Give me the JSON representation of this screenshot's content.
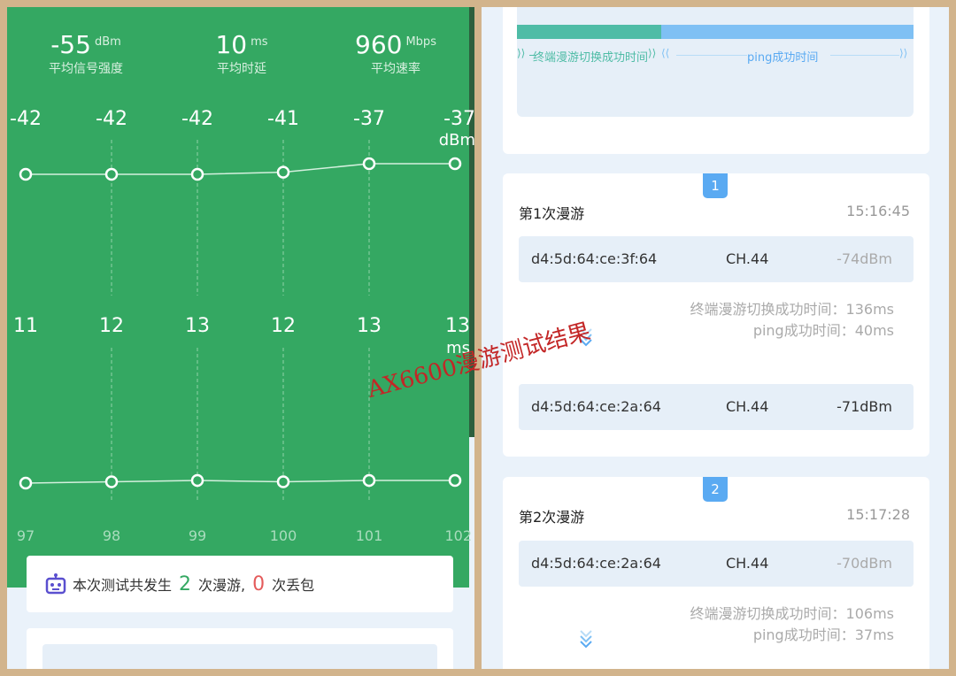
{
  "left": {
    "stats": [
      {
        "value": "-55",
        "unit": "dBm",
        "label": "平均信号强度"
      },
      {
        "value": "10",
        "unit": "ms",
        "label": "平均时延"
      },
      {
        "value": "960",
        "unit": "Mbps",
        "label": "平均速率"
      }
    ],
    "summary": {
      "prefix": "本次测试共发生",
      "roam_count": "2",
      "roam_label": "次漫游,",
      "loss_count": "0",
      "loss_label": "次丢包"
    }
  },
  "chart_data": {
    "type": "line",
    "x": [
      "97",
      "98",
      "99",
      "100",
      "101",
      "102"
    ],
    "series": [
      {
        "name": "",
        "unit": "dBm",
        "values": [
          -42,
          -42,
          -42,
          -41,
          -37,
          -37
        ]
      },
      {
        "name": "",
        "unit": "ms",
        "values": [
          11,
          12,
          13,
          12,
          13,
          13
        ]
      }
    ],
    "signal_labels": [
      "-42",
      "-42",
      "-42",
      "-41",
      "-37",
      "-37"
    ],
    "latency_labels": [
      "11",
      "12",
      "13",
      "12",
      "13",
      "13"
    ],
    "signal_unit": "dBm",
    "latency_unit": "ms"
  },
  "right": {
    "legend": {
      "left_label": "终端漫游切换成功时间",
      "right_label": "ping成功时间",
      "color_left": "#4fbca6",
      "color_right": "#7fc0f4"
    },
    "roams": [
      {
        "index": "1",
        "title": "第1次漫游",
        "time": "15:16:45",
        "from": {
          "mac": "d4:5d:64:ce:3f:64",
          "channel": "CH.44",
          "signal": "-74dBm"
        },
        "switch_time": "终端漫游切换成功时间：136ms",
        "ping_time": "ping成功时间：40ms",
        "to": {
          "mac": "d4:5d:64:ce:2a:64",
          "channel": "CH.44",
          "signal": "-71dBm"
        }
      },
      {
        "index": "2",
        "title": "第2次漫游",
        "time": "15:17:28",
        "from": {
          "mac": "d4:5d:64:ce:2a:64",
          "channel": "CH.44",
          "signal": "-70dBm"
        },
        "switch_time": "终端漫游切换成功时间：106ms",
        "ping_time": "ping成功时间：37ms"
      }
    ]
  },
  "watermark": "AX6600漫游测试结果",
  "colors": {
    "green": "#34a862",
    "accent_blue": "#5aaaf2",
    "red": "#e45b5b"
  }
}
